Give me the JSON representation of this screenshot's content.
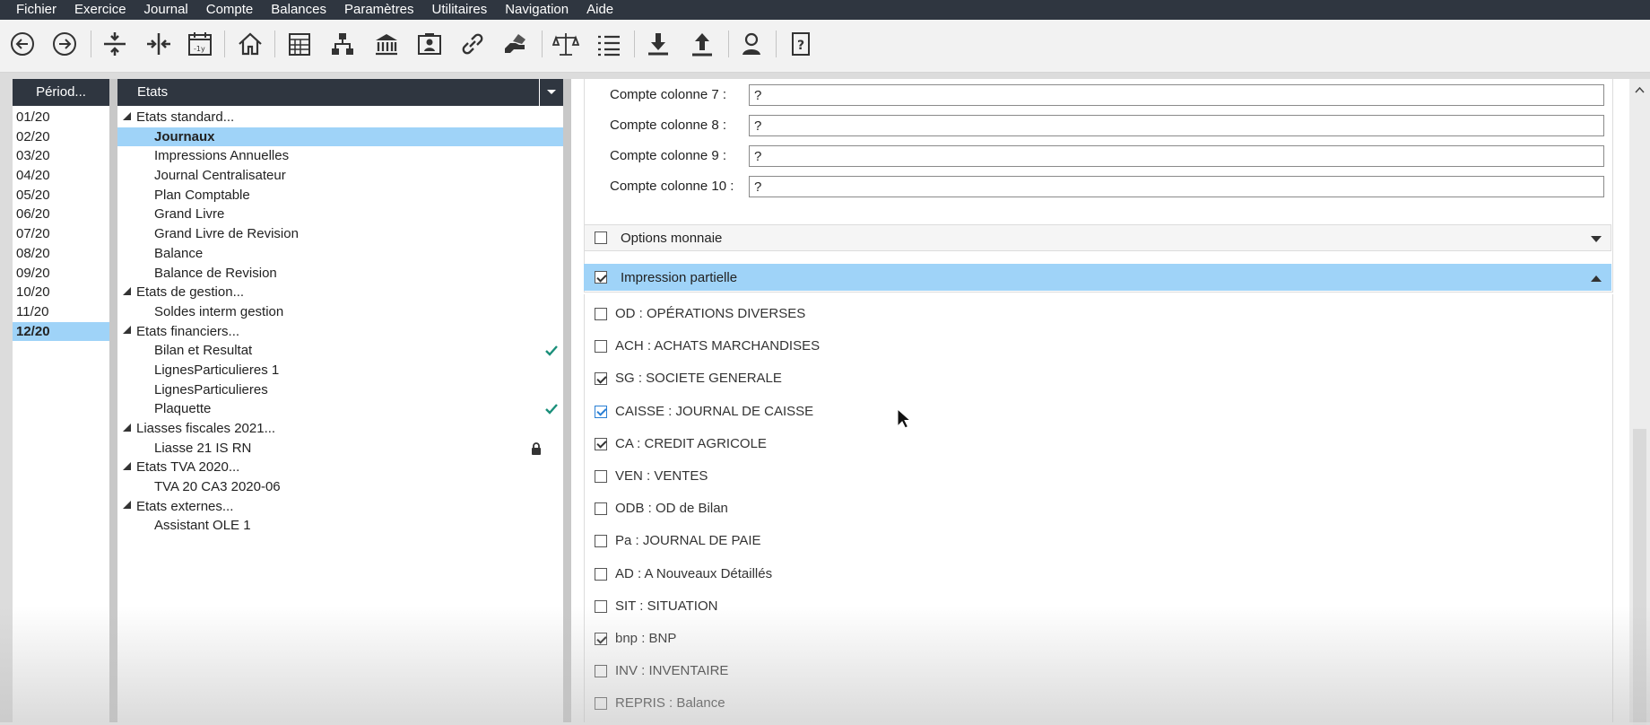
{
  "menu": [
    "Fichier",
    "Exercice",
    "Journal",
    "Compte",
    "Balances",
    "Paramètres",
    "Utilitaires",
    "Navigation",
    "Aide"
  ],
  "toolbar_icons": [
    "back-icon",
    "forward-icon",
    "expand-rows-icon",
    "collapse-columns-icon",
    "calendar-minus-year-icon",
    "home-icon",
    "calculator-grid-icon",
    "org-chart-icon",
    "bank-icon",
    "contact-card-icon",
    "link-icon",
    "hand-money-icon",
    "scales-icon",
    "list-icon",
    "download-icon",
    "upload-icon",
    "user-icon",
    "help-icon"
  ],
  "period_pane": {
    "header": "Périod...",
    "items": [
      "01/20",
      "02/20",
      "03/20",
      "04/20",
      "05/20",
      "06/20",
      "07/20",
      "08/20",
      "09/20",
      "10/20",
      "11/20",
      "12/20"
    ],
    "selected": "12/20"
  },
  "etats_pane": {
    "header": "Etats",
    "tree": [
      {
        "label": "Etats standard...",
        "type": "group"
      },
      {
        "label": "Journaux",
        "type": "leaf",
        "selected": true
      },
      {
        "label": "Impressions Annuelles",
        "type": "leaf"
      },
      {
        "label": "Journal Centralisateur",
        "type": "leaf"
      },
      {
        "label": "Plan Comptable",
        "type": "leaf"
      },
      {
        "label": "Grand Livre",
        "type": "leaf"
      },
      {
        "label": "Grand Livre de Revision",
        "type": "leaf"
      },
      {
        "label": "Balance",
        "type": "leaf"
      },
      {
        "label": "Balance de Revision",
        "type": "leaf"
      },
      {
        "label": "Etats de gestion...",
        "type": "group"
      },
      {
        "label": "Soldes interm gestion",
        "type": "leaf"
      },
      {
        "label": "Etats financiers...",
        "type": "group"
      },
      {
        "label": "Bilan et Resultat",
        "type": "leaf",
        "mark": "check"
      },
      {
        "label": "LignesParticulieres 1",
        "type": "leaf"
      },
      {
        "label": "LignesParticulieres",
        "type": "leaf"
      },
      {
        "label": "Plaquette",
        "type": "leaf",
        "mark": "check"
      },
      {
        "label": "Liasses fiscales 2021...",
        "type": "group"
      },
      {
        "label": "Liasse 21 IS RN",
        "type": "leaf",
        "mark": "lock"
      },
      {
        "label": "Etats TVA 2020...",
        "type": "group"
      },
      {
        "label": "TVA 20 CA3 2020-06",
        "type": "leaf"
      },
      {
        "label": "Etats externes...",
        "type": "group"
      },
      {
        "label": "Assistant OLE 1",
        "type": "leaf"
      }
    ]
  },
  "columns": [
    {
      "label": "Compte colonne 7 :",
      "value": "?"
    },
    {
      "label": "Compte colonne 8 :",
      "value": "?"
    },
    {
      "label": "Compte colonne 9 :",
      "value": "?"
    },
    {
      "label": "Compte colonne 10 :",
      "value": "?"
    }
  ],
  "options_monnaie": {
    "label": "Options monnaie",
    "checked": false
  },
  "impression_partielle": {
    "label": "Impression partielle",
    "checked": true
  },
  "journals": [
    {
      "label": "OD : OPÉRATIONS DIVERSES",
      "checked": false
    },
    {
      "label": "ACH : ACHATS MARCHANDISES",
      "checked": false
    },
    {
      "label": "SG : SOCIETE GENERALE",
      "checked": true
    },
    {
      "label": "CAISSE : JOURNAL DE CAISSE",
      "checked": true,
      "hover": true
    },
    {
      "label": "CA : CREDIT AGRICOLE",
      "checked": true
    },
    {
      "label": "VEN : VENTES",
      "checked": false
    },
    {
      "label": "ODB : OD de Bilan",
      "checked": false
    },
    {
      "label": "Pa : JOURNAL DE PAIE",
      "checked": false
    },
    {
      "label": "AD : A Nouveaux Détaillés",
      "checked": false
    },
    {
      "label": "SIT : SITUATION",
      "checked": false
    },
    {
      "label": "bnp : BNP",
      "checked": true
    },
    {
      "label": "INV : INVENTAIRE",
      "checked": false
    },
    {
      "label": "REPRIS : Balance",
      "checked": false
    }
  ],
  "colors": {
    "menubar_bg": "#2f3640",
    "selection": "#9fd3f8",
    "check_green": "#1a8f7a"
  }
}
